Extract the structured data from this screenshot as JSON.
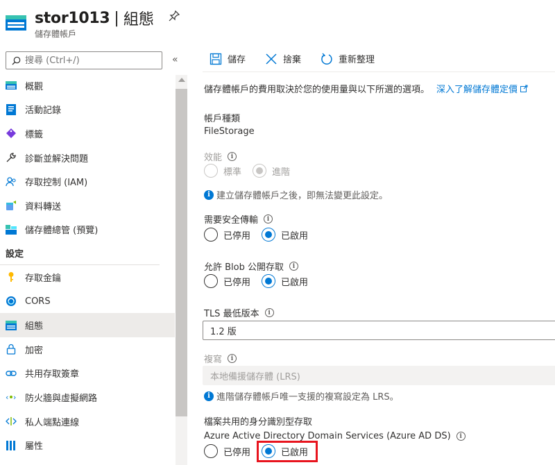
{
  "header": {
    "title": "stor1013",
    "separator": "|",
    "blade_title": "組態",
    "subtitle": "儲存體帳戶"
  },
  "sidebar": {
    "search_placeholder": "搜尋 (Ctrl+/)",
    "collapse": "«",
    "items": [
      {
        "label": "概觀",
        "icon": "overview-icon"
      },
      {
        "label": "活動記錄",
        "icon": "activity-log-icon"
      },
      {
        "label": "標籤",
        "icon": "tag-icon"
      },
      {
        "label": "診斷並解決問題",
        "icon": "wrench-icon"
      },
      {
        "label": "存取控制 (IAM)",
        "icon": "people-icon"
      },
      {
        "label": "資料轉送",
        "icon": "data-transfer-icon"
      },
      {
        "label": "儲存體總管 (預覽)",
        "icon": "storage-explorer-icon"
      }
    ],
    "section_header": "設定",
    "settings_items": [
      {
        "label": "存取金鑰",
        "icon": "key-icon"
      },
      {
        "label": "CORS",
        "icon": "cors-icon"
      },
      {
        "label": "組態",
        "icon": "configuration-icon",
        "active": true
      },
      {
        "label": "加密",
        "icon": "lock-icon"
      },
      {
        "label": "共用存取簽章",
        "icon": "link-icon"
      },
      {
        "label": "防火牆與虛擬網路",
        "icon": "firewall-icon"
      },
      {
        "label": "私人端點連線",
        "icon": "private-endpoint-icon"
      },
      {
        "label": "屬性",
        "icon": "properties-icon"
      }
    ]
  },
  "toolbar": {
    "save": "儲存",
    "discard": "捨棄",
    "refresh": "重新整理"
  },
  "main": {
    "description": "儲存體帳戶的費用取決於您的使用量與以下所選的選項。",
    "learn_more": "深入了解儲存體定價",
    "account_kind_label": "帳戶種類",
    "account_kind_value": "FileStorage",
    "performance_label": "效能",
    "performance_options": [
      "標準",
      "進階"
    ],
    "performance_note": "建立儲存體帳戶之後，即無法變更此設定。",
    "secure_transfer_label": "需要安全傳輸",
    "blob_public_label": "允許 Blob 公開存取",
    "disabled_label": "已停用",
    "enabled_label": "已啟用",
    "tls_label": "TLS 最低版本",
    "tls_value": "1.2 版",
    "replication_label": "複寫",
    "replication_value": "本地備援儲存體 (LRS)",
    "replication_note": "進階儲存體帳戶唯一支援的複寫設定為 LRS。",
    "identity_section": "檔案共用的身分識別型存取",
    "aadds_label": "Azure Active Directory Domain Services (Azure AD DS)"
  },
  "colors": {
    "accent": "#0078d4",
    "highlight": "#e8141e"
  }
}
